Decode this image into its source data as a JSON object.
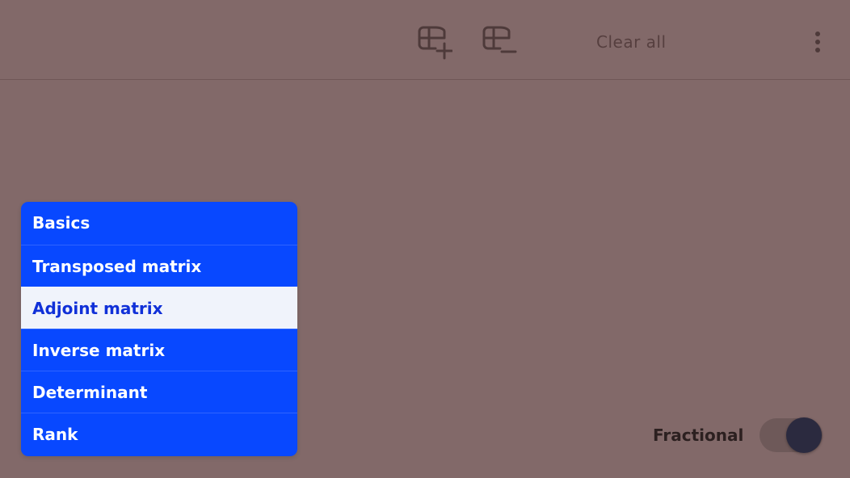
{
  "toolbar": {
    "add_matrix_icon": "matrix-add-icon",
    "remove_matrix_icon": "matrix-remove-icon",
    "clear_all_label": "Clear all",
    "more_icon": "more-vertical-icon"
  },
  "menu": {
    "items": [
      {
        "label": "Basics",
        "selected": false
      },
      {
        "label": "Transposed matrix",
        "selected": false
      },
      {
        "label": "Adjoint matrix",
        "selected": true
      },
      {
        "label": "Inverse matrix",
        "selected": false
      },
      {
        "label": "Determinant",
        "selected": false
      },
      {
        "label": "Rank",
        "selected": false
      }
    ]
  },
  "options": {
    "fractional_label": "Fractional",
    "fractional_enabled": true
  },
  "colors": {
    "background": "#826969",
    "menu_accent": "#0848ff",
    "selected_background": "#f0f3fb",
    "selected_text": "#1030d8"
  }
}
